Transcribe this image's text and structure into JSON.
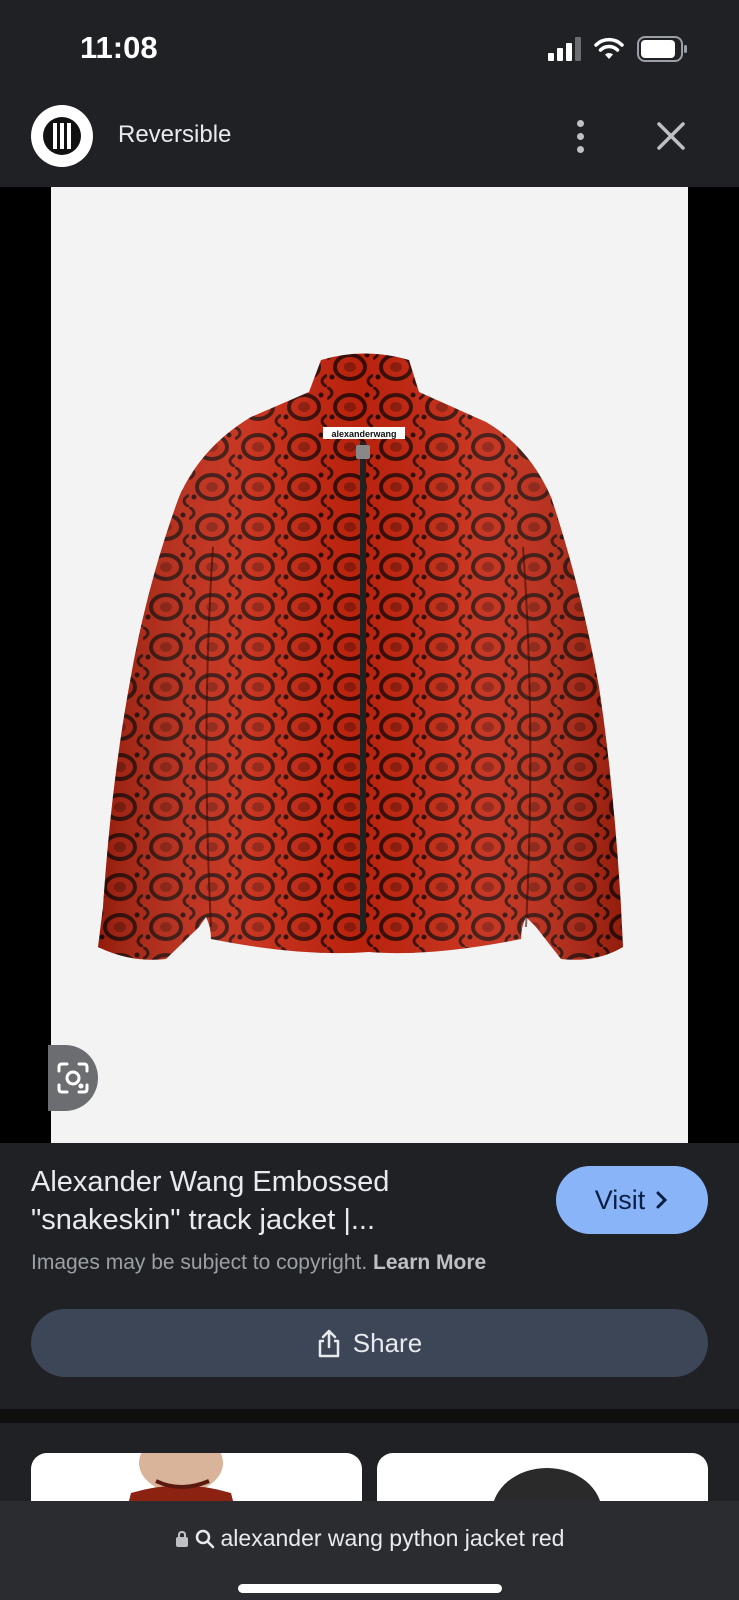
{
  "status": {
    "time": "11:08",
    "signal_icon": "signal-icon",
    "wifi_icon": "wifi-icon",
    "battery_icon": "battery-icon"
  },
  "header": {
    "site_name": "Reversible",
    "more_icon": "more-vert-icon",
    "close_icon": "close-icon"
  },
  "image": {
    "description_icon": "lens-icon",
    "collar_label": "alexanderwang"
  },
  "result": {
    "title": "Alexander Wang Embossed \"snakeskin\" track jacket |...",
    "visit_label": "Visit",
    "copyright_text": "Images may be subject to copyright.",
    "learn_more": "Learn More",
    "share_label": "Share"
  },
  "url_bar": {
    "query": "alexander wang python jacket red"
  },
  "colors": {
    "background": "#202124",
    "accent": "#8ab4f8",
    "share_bg": "#3c4657",
    "jacket": "#c82a14"
  }
}
